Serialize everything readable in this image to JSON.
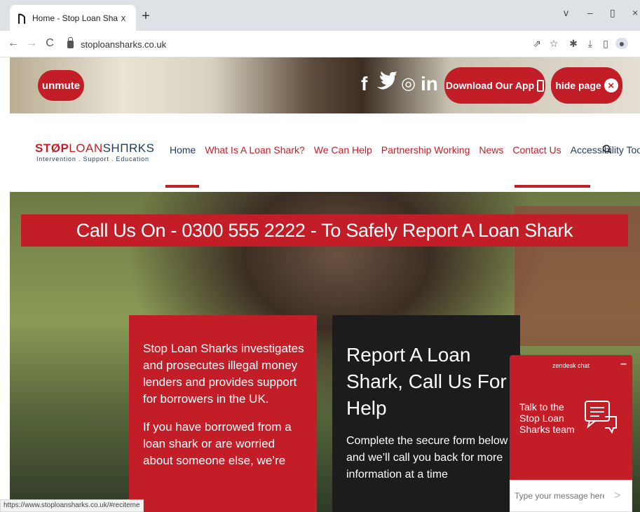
{
  "browser": {
    "tab_title": "Home - Stop Loan Sharks",
    "tab_close": "x",
    "new_tab": "+",
    "url": "stoploansharks.co.uk",
    "window_controls": [
      "v",
      "–",
      "▯",
      "×"
    ],
    "status_url": "https://www.stoploansharks.co.uk/#reciteme"
  },
  "banner": {
    "unmute": "unmute",
    "social": [
      "f",
      "y",
      "◎",
      "in"
    ],
    "download_app": "Download Our App",
    "hide_page": "hide page"
  },
  "header": {
    "logo_part1": "STØP",
    "logo_part2": "LOAN",
    "logo_part3": "SHΠRKS",
    "logo_tagline": "Intervention . Support . Education",
    "nav": [
      "Home",
      "What Is A Loan Shark?",
      "We Can Help",
      "Partnership Working",
      "News",
      "Contact Us",
      "Accessibility Tools"
    ]
  },
  "hero": {
    "call_banner": "Call Us On - 0300 555 2222 - To Safely Report A Loan Shark",
    "red_card": {
      "para1": "Stop Loan Sharks investigates and prosecutes illegal money lenders and provides support for borrowers in the UK.",
      "para2": "If you have borrowed from a loan shark or are worried about someone else, we’re"
    },
    "dark_card": {
      "heading": "Report A Loan Shark, Call Us For Help",
      "text": "Complete the secure form below and we’ll call you back for more information at a time"
    }
  },
  "chat": {
    "header": "zendesk chat",
    "minimize": "–",
    "message": "Talk to the Stop Loan Sharks team",
    "placeholder": "Type your message here",
    "send": ">"
  },
  "colors": {
    "brand_red": "#c31e28",
    "navy": "#1f3a5f"
  }
}
